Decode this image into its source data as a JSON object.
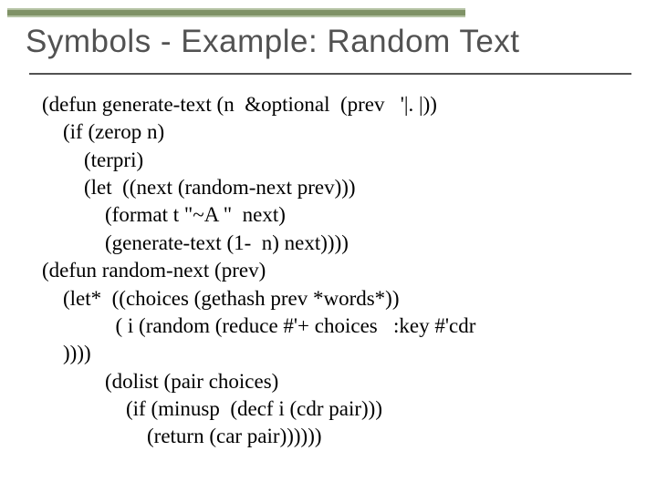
{
  "title": "Symbols - Example: Random Text",
  "code": {
    "l1": "(defun generate-text (n  &optional  (prev   '|. |))",
    "l2": "    (if (zerop n)",
    "l3": "        (terpri)",
    "l4": "        (let  ((next (random-next prev)))",
    "l5": "            (format t \"~A \"  next)",
    "l6": "            (generate-text (1-  n) next))))",
    "l7": "(defun random-next (prev)",
    "l8": "    (let*  ((choices (gethash prev *words*))",
    "l9": "              ( i (random (reduce #'+ choices   :key #'cdr",
    "l10": "    ))))",
    "l11": "            (dolist (pair choices)",
    "l12": "                (if (minusp  (decf i (cdr pair)))",
    "l13": "                    (return (car pair))))))"
  }
}
